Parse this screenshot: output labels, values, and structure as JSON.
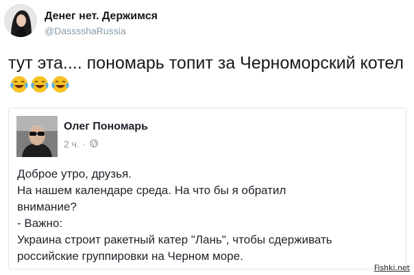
{
  "tweet": {
    "author_name": "Денег нет. Держимся",
    "author_handle": "@DasssshaRussia",
    "text": "тут эта.... пономарь топит за  Черноморский котел",
    "emojis": [
      "tears-of-joy-emoji",
      "tears-of-joy-emoji",
      "tears-of-joy-emoji"
    ]
  },
  "quoted_post": {
    "author_name": "Олег Пономарь",
    "time": "2 ч.",
    "separator": "·",
    "privacy_icon": "globe-icon",
    "lines": [
      "Доброе утро, друзья.",
      "На нашем календаре среда. На что бы я обратил",
      "внимание?",
      "- Важно:",
      "Украина строит ракетный катер \"Лань\", чтобы сдерживать",
      "российские группировки на Черном море."
    ]
  },
  "watermark": "Fishki.net"
}
